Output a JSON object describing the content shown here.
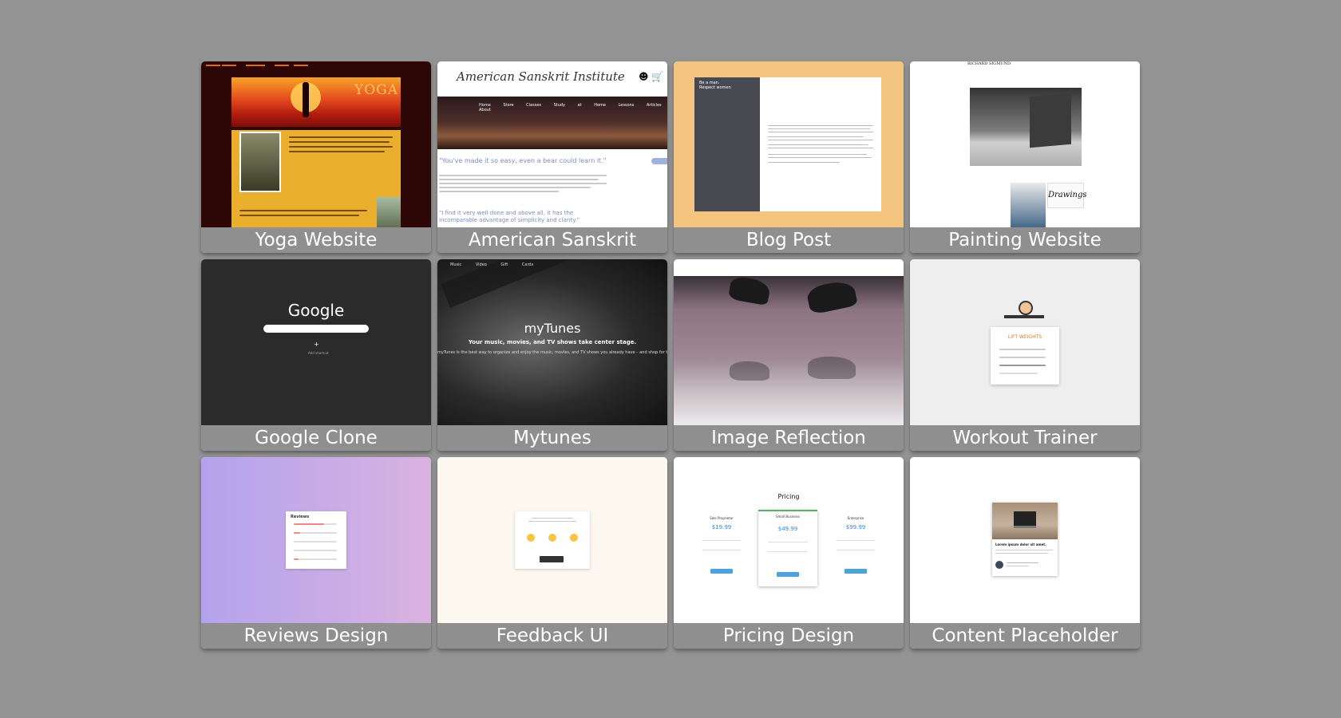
{
  "projects": [
    {
      "label": "Yoga Website"
    },
    {
      "label": "American Sanskrit"
    },
    {
      "label": "Blog Post"
    },
    {
      "label": "Painting Website"
    },
    {
      "label": "Google Clone"
    },
    {
      "label": "Mytunes"
    },
    {
      "label": "Image Reflection"
    },
    {
      "label": "Workout Trainer"
    },
    {
      "label": "Reviews Design"
    },
    {
      "label": "Feedback UI"
    },
    {
      "label": "Pricing Design"
    },
    {
      "label": "Content Placeholder"
    }
  ],
  "thumbs": {
    "yoga": {
      "title": "YOGA"
    },
    "sanskrit": {
      "title": "American Sanskrit Institute",
      "nav": "Home Store Classes Study at Home Lessons Articles About",
      "quote": "\"You've made it so easy, even a bear could learn it.\"",
      "quote2": "\"I find it very well done and above all, it has the incomparable advantage of simplicity and clarity.\""
    },
    "blog": {
      "side_text": "Be a man.\nRespect women"
    },
    "painting": {
      "header": "RICHARD SIGMUND",
      "small_text": "Drawings"
    },
    "google": {
      "logo": "Google",
      "plus": "+",
      "shortcut": "Add shortcut"
    },
    "mytunes": {
      "nav": "Music Video Gift Cards",
      "title": "myTunes",
      "subtitle": "Your music, movies, and TV shows take center stage.",
      "desc": "myTunes is the best way to organize and enjoy the music, movies, and TV shows you already have – and shop for the ones you want. Enjoy all the entertainment myTunes has to offer on your Mac and PC."
    },
    "workout": {
      "title": "LIFT WEIGHTS"
    },
    "reviews": {
      "title": "Reviews"
    },
    "pricing": {
      "title": "Pricing",
      "plans": [
        {
          "name": "Sole Proprietor",
          "price": "$19.99"
        },
        {
          "name": "Small Business",
          "price": "$49.99"
        },
        {
          "name": "Enterprise",
          "price": "$99.99"
        }
      ]
    },
    "placeholder": {
      "title": "Lorem ipsum dolor sit amet."
    }
  },
  "colors": {
    "page_bg": "#939393",
    "label_bg": "#8f8f8f",
    "label_text": "#ffffff"
  }
}
